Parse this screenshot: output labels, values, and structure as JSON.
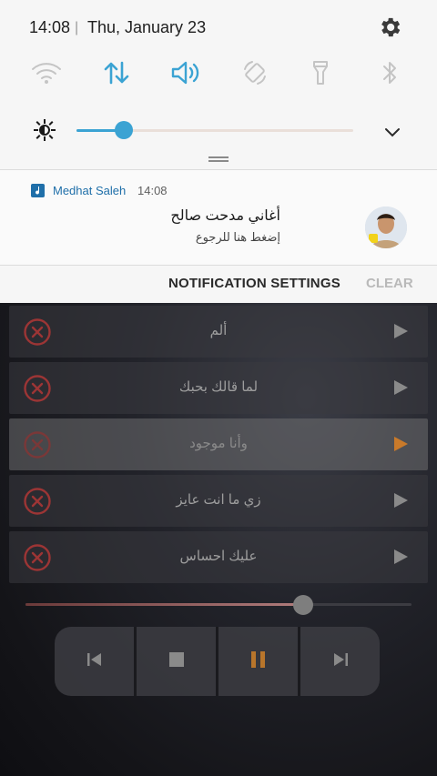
{
  "status": {
    "time": "14:08",
    "separator": "|",
    "date": "Thu, January 23"
  },
  "quick_settings": [
    {
      "icon": "wifi-icon",
      "active": false
    },
    {
      "icon": "mobile-data-icon",
      "active": true
    },
    {
      "icon": "sound-icon",
      "active": true
    },
    {
      "icon": "auto-rotate-icon",
      "active": false
    },
    {
      "icon": "flashlight-icon",
      "active": false
    },
    {
      "icon": "bluetooth-icon",
      "active": false
    }
  ],
  "brightness": {
    "level": 0.17
  },
  "notification": {
    "app_name": "Medhat Saleh",
    "time": "14:08",
    "title": "أغاني مدحت صالح",
    "text": "إضغط هنا للرجوع"
  },
  "actions": {
    "settings": "NOTIFICATION SETTINGS",
    "clear": "CLEAR"
  },
  "songs": [
    {
      "title": "ألم",
      "active": false
    },
    {
      "title": "لما قالك بحبك",
      "active": false
    },
    {
      "title": "وأنا موجود",
      "active": true
    },
    {
      "title": "زي ما انت عايز",
      "active": false
    },
    {
      "title": "عليك احساس",
      "active": false
    }
  ],
  "playback": {
    "progress": 0.72
  },
  "controls": [
    {
      "icon": "previous-icon"
    },
    {
      "icon": "stop-icon"
    },
    {
      "icon": "pause-icon"
    },
    {
      "icon": "next-icon"
    }
  ],
  "colors": {
    "accent": "#3ba3d3",
    "active_play": "#c97a2a",
    "close_red": "#b23a3a",
    "app_link": "#1f6fa9"
  }
}
